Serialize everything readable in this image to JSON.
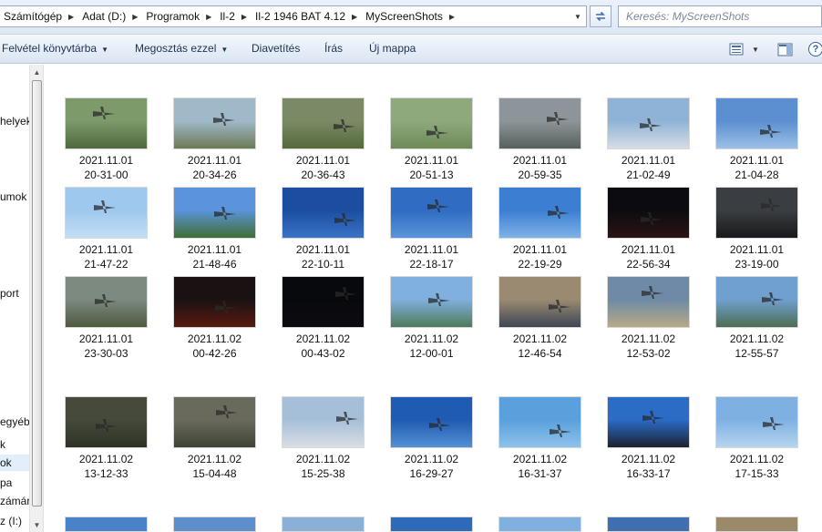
{
  "address": {
    "crumbs": [
      "Számítógép",
      "Adat (D:)",
      "Programok",
      "Il-2",
      "Il-2 1946 BAT 4.12",
      "MyScreenShots"
    ]
  },
  "search": {
    "placeholder": "Keresés: MyScreenShots"
  },
  "toolbar": {
    "add_to_library": "Felvétel könyvtárba",
    "share_with": "Megosztás ezzel",
    "slideshow": "Diavetítés",
    "burn": "Írás",
    "new_folder": "Új mappa",
    "help": "?"
  },
  "nav": {
    "items": [
      "helyek",
      "umok",
      "port",
      "egyéb",
      "k",
      "ok",
      "pa",
      "zámár",
      "z (I:)"
    ],
    "selected_index": 5
  },
  "files": [
    {
      "date": "2021.11.01",
      "time": "20-31-00",
      "sky": "#7c9a6a",
      "ground": "#4e6a3e"
    },
    {
      "date": "2021.11.01",
      "time": "20-34-26",
      "sky": "#9fb9c9",
      "ground": "#6c7a54"
    },
    {
      "date": "2021.11.01",
      "time": "20-36-43",
      "sky": "#7b8a66",
      "ground": "#556a3a"
    },
    {
      "date": "2021.11.01",
      "time": "20-51-13",
      "sky": "#8eaa7c",
      "ground": "#6d8a58"
    },
    {
      "date": "2021.11.01",
      "time": "20-59-35",
      "sky": "#8e959a",
      "ground": "#56605c"
    },
    {
      "date": "2021.11.01",
      "time": "21-02-49",
      "sky": "#8fb3d6",
      "ground": "#d6dde6"
    },
    {
      "date": "2021.11.01",
      "time": "21-04-28",
      "sky": "#5b8fcf",
      "ground": "#9cc0e6"
    },
    {
      "date": "2021.11.01",
      "time": "21-47-22",
      "sky": "#9ec8ee",
      "ground": "#c3def4"
    },
    {
      "date": "2021.11.01",
      "time": "21-48-46",
      "sky": "#5b94dc",
      "ground": "#3f6e33"
    },
    {
      "date": "2021.11.01",
      "time": "22-10-11",
      "sky": "#1b4e9e",
      "ground": "#3b73c6"
    },
    {
      "date": "2021.11.01",
      "time": "22-18-17",
      "sky": "#2f6cc2",
      "ground": "#5a95d8"
    },
    {
      "date": "2021.11.01",
      "time": "22-19-29",
      "sky": "#3b7ed2",
      "ground": "#7fb2e8"
    },
    {
      "date": "2021.11.01",
      "time": "22-56-34",
      "sky": "#0c0c10",
      "ground": "#2a1412"
    },
    {
      "date": "2021.11.01",
      "time": "23-19-00",
      "sky": "#3a3e42",
      "ground": "#18191b"
    },
    {
      "date": "2021.11.01",
      "time": "23-30-03",
      "sky": "#7c8a80",
      "ground": "#4f5a3e"
    },
    {
      "date": "2021.11.02",
      "time": "00-42-26",
      "sky": "#1a1212",
      "ground": "#5a1a10"
    },
    {
      "date": "2021.11.02",
      "time": "00-43-02",
      "sky": "#08090c",
      "ground": "#0c0c10"
    },
    {
      "date": "2021.11.02",
      "time": "12-00-01",
      "sky": "#7fb0de",
      "ground": "#4f7a5a"
    },
    {
      "date": "2021.11.02",
      "time": "12-46-54",
      "sky": "#9a8a72",
      "ground": "#3e4654"
    },
    {
      "date": "2021.11.02",
      "time": "12-53-02",
      "sky": "#6f8aa6",
      "ground": "#b7a987"
    },
    {
      "date": "2021.11.02",
      "time": "12-55-57",
      "sky": "#6fa0cf",
      "ground": "#4e6e52"
    },
    {
      "date": "2021.11.02",
      "time": "13-12-33",
      "sky": "#454a3a",
      "ground": "#2c3326"
    },
    {
      "date": "2021.11.02",
      "time": "15-04-48",
      "sky": "#6a6a5c",
      "ground": "#3e4434"
    },
    {
      "date": "2021.11.02",
      "time": "15-25-38",
      "sky": "#a6bfd8",
      "ground": "#d8dee4"
    },
    {
      "date": "2021.11.02",
      "time": "16-29-27",
      "sky": "#1f5bb2",
      "ground": "#5490d2"
    },
    {
      "date": "2021.11.02",
      "time": "16-31-37",
      "sky": "#5aa0dd",
      "ground": "#8ec3ea"
    },
    {
      "date": "2021.11.02",
      "time": "16-33-17",
      "sky": "#2a6cc6",
      "ground": "#1b2230"
    },
    {
      "date": "2021.11.02",
      "time": "17-15-33",
      "sky": "#7eb1e2",
      "ground": "#b6d4ee"
    }
  ],
  "partial_row_colors": [
    "#4a82c8",
    "#5d8fcc",
    "#8ab0d8",
    "#2f6ab8",
    "#7fb0e0",
    "#3e6fb0",
    "#9a8a6a"
  ]
}
